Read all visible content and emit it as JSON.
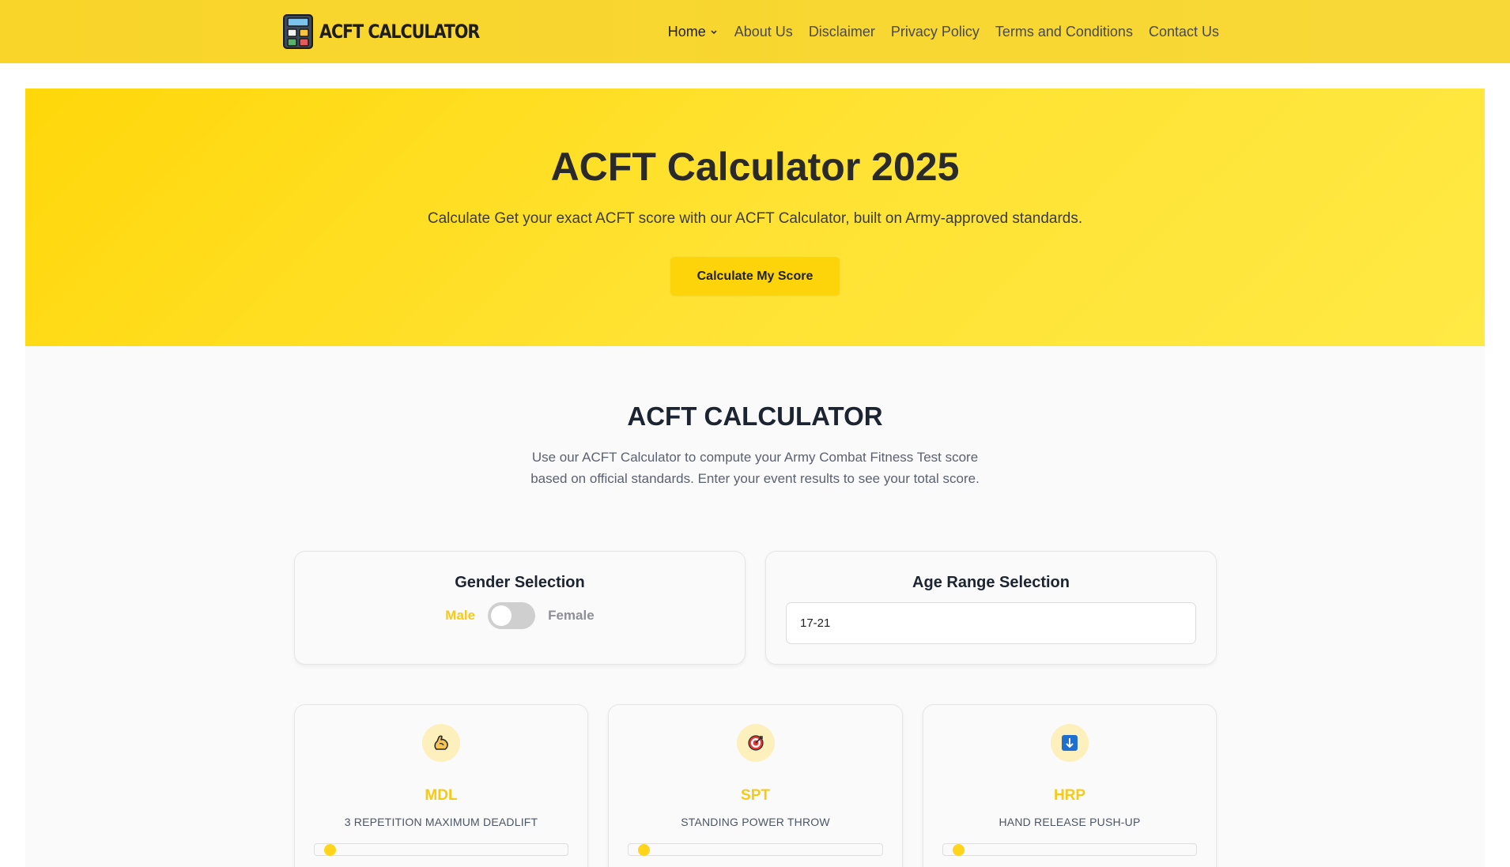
{
  "header": {
    "logo_text": "ACFT CALCULATOR",
    "nav": [
      {
        "label": "Home"
      },
      {
        "label": "About Us"
      },
      {
        "label": "Disclaimer"
      },
      {
        "label": "Privacy Policy"
      },
      {
        "label": "Terms and Conditions"
      },
      {
        "label": "Contact Us"
      }
    ]
  },
  "hero": {
    "title": "ACFT Calculator 2025",
    "subtitle": "Calculate Get your exact ACFT score with our ACFT Calculator, built on Army-approved standards.",
    "button_label": "Calculate My Score"
  },
  "calculator": {
    "title": "ACFT CALCULATOR",
    "description": "Use our ACFT Calculator to compute your Army Combat Fitness Test score based on official standards. Enter your event results to see your total score.",
    "gender": {
      "title": "Gender Selection",
      "male_label": "Male",
      "female_label": "Female",
      "selected": "Male"
    },
    "age": {
      "title": "Age Range Selection",
      "selected": "17-21"
    },
    "events": [
      {
        "code": "MDL",
        "name": "3 REPETITION MAXIMUM DEADLIFT",
        "icon": "flexed-biceps-icon",
        "slider_level": 0
      },
      {
        "code": "SPT",
        "name": "STANDING POWER THROW",
        "icon": "target-icon",
        "slider_level": 0
      },
      {
        "code": "HRP",
        "name": "HAND RELEASE PUSH-UP",
        "icon": "down-arrow-icon",
        "slider_level": 0
      }
    ]
  },
  "colors": {
    "header_bg": "#f9d52a",
    "hero_bg": "#ffe232",
    "accent": "#f5ca18",
    "button_bg": "#fdd30a",
    "heading": "#1c2431"
  }
}
